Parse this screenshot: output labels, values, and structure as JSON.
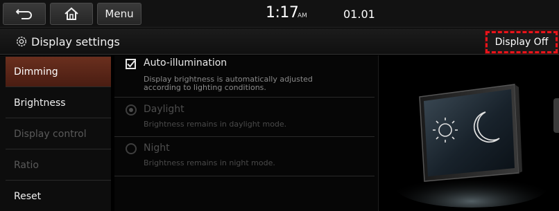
{
  "topbar": {
    "menu_label": "Menu",
    "time": "1:17",
    "ampm": "AM",
    "date": "01.01"
  },
  "title": {
    "text": "Display settings",
    "display_off_label": "Display Off"
  },
  "sidebar": {
    "items": [
      {
        "label": "Dimming",
        "state": "active"
      },
      {
        "label": "Brightness",
        "state": "enabled"
      },
      {
        "label": "Display control",
        "state": "disabled"
      },
      {
        "label": "Ratio",
        "state": "disabled"
      },
      {
        "label": "Reset",
        "state": "enabled"
      }
    ]
  },
  "options": {
    "auto": {
      "label": "Auto-illumination",
      "checked": true,
      "desc_line1": "Display brightness is automatically adjusted",
      "desc_line2": "according to lighting conditions."
    },
    "daylight": {
      "label": "Daylight",
      "desc": "Brightness remains in daylight mode.",
      "selected": true,
      "enabled": false
    },
    "night": {
      "label": "Night",
      "desc": "Brightness remains in night mode.",
      "selected": false,
      "enabled": false
    }
  },
  "icons": {
    "back": "back-arrow-icon",
    "home": "home-icon",
    "settings": "gear-icon",
    "sun": "sun-icon",
    "moon": "moon-icon"
  },
  "colors": {
    "active_item": "#5a2618",
    "highlight_border": "#e8141b"
  }
}
